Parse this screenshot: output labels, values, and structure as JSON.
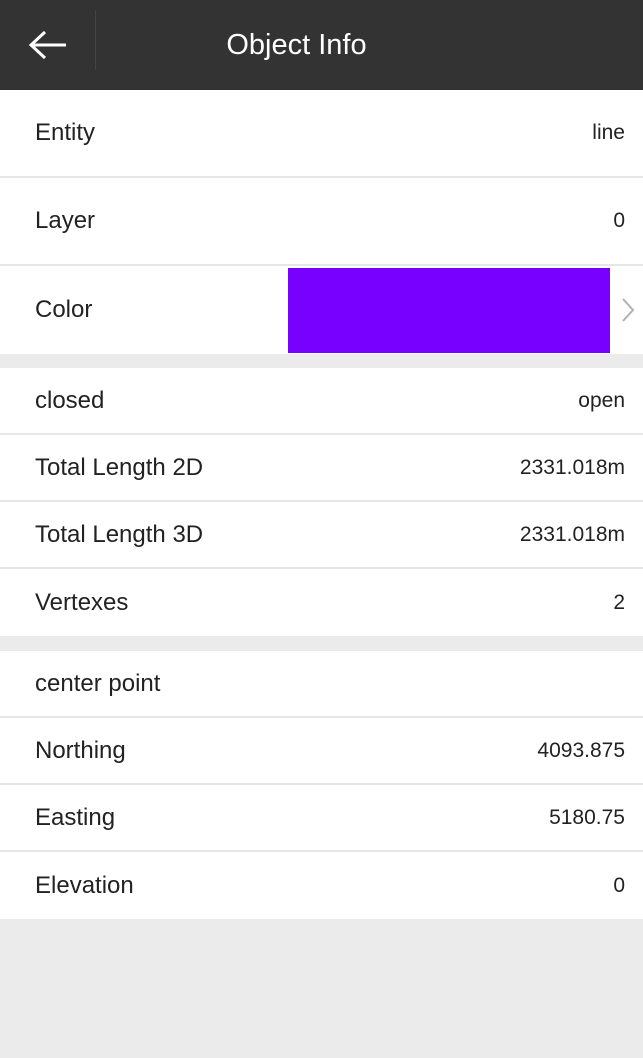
{
  "header": {
    "title": "Object Info",
    "back_icon": "arrow-left-icon"
  },
  "colors": {
    "header_bg": "#333333",
    "entity_color": "#7800ff",
    "background": "#ebebeb"
  },
  "group1": {
    "entity": {
      "label": "Entity",
      "value": "line"
    },
    "layer": {
      "label": "Layer",
      "value": "0"
    },
    "color": {
      "label": "Color",
      "icon": "chevron-right-icon"
    }
  },
  "group2": {
    "closed": {
      "label": "closed",
      "value": "open"
    },
    "total_length_2d": {
      "label": "Total Length 2D",
      "value": "2331.018m"
    },
    "total_length_3d": {
      "label": "Total Length 3D",
      "value": "2331.018m"
    },
    "vertexes": {
      "label": "Vertexes",
      "value": "2"
    }
  },
  "group3": {
    "center_point": {
      "label": "center point"
    },
    "northing": {
      "label": "Northing",
      "value": "4093.875"
    },
    "easting": {
      "label": "Easting",
      "value": "5180.75"
    },
    "elevation": {
      "label": "Elevation",
      "value": "0"
    }
  }
}
